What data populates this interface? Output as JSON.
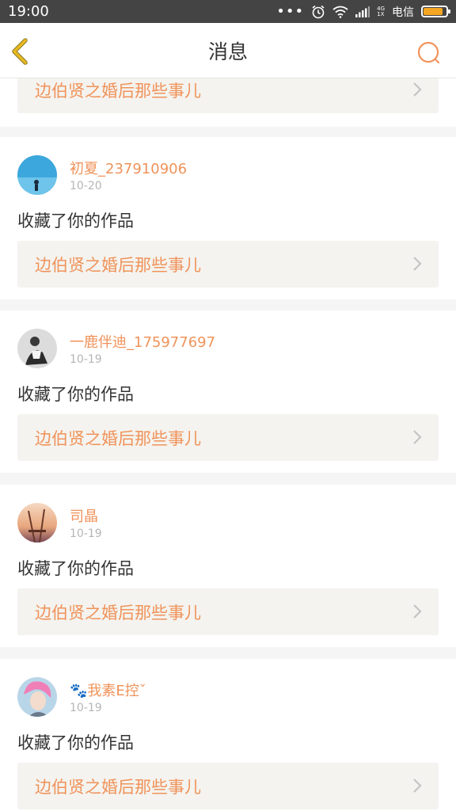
{
  "status_bar": {
    "time": "19:00",
    "dots": "•••",
    "net_top": "4G",
    "net_bottom": "1X",
    "carrier": "电信",
    "battery_level": 0.85
  },
  "header": {
    "title": "消息"
  },
  "top_partial": {
    "work_title": "边伯贤之婚后那些事儿"
  },
  "notifications": [
    {
      "username": "初夏_237910906",
      "date": "10-20",
      "action": "收藏了你的作品",
      "work_title": "边伯贤之婚后那些事儿"
    },
    {
      "username": "一鹿伴迪_175977697",
      "date": "10-19",
      "action": "收藏了你的作品",
      "work_title": "边伯贤之婚后那些事儿"
    },
    {
      "username": "司晶",
      "date": "10-19",
      "action": "收藏了你的作品",
      "work_title": "边伯贤之婚后那些事儿"
    },
    {
      "username": "🐾我素E控ˇ",
      "date": "10-19",
      "action": "收藏了你的作品",
      "work_title": "边伯贤之婚后那些事儿"
    }
  ],
  "colors": {
    "accent": "#f0935a",
    "back_icon": "#e8b820",
    "status_bar_bg": "#444444"
  }
}
